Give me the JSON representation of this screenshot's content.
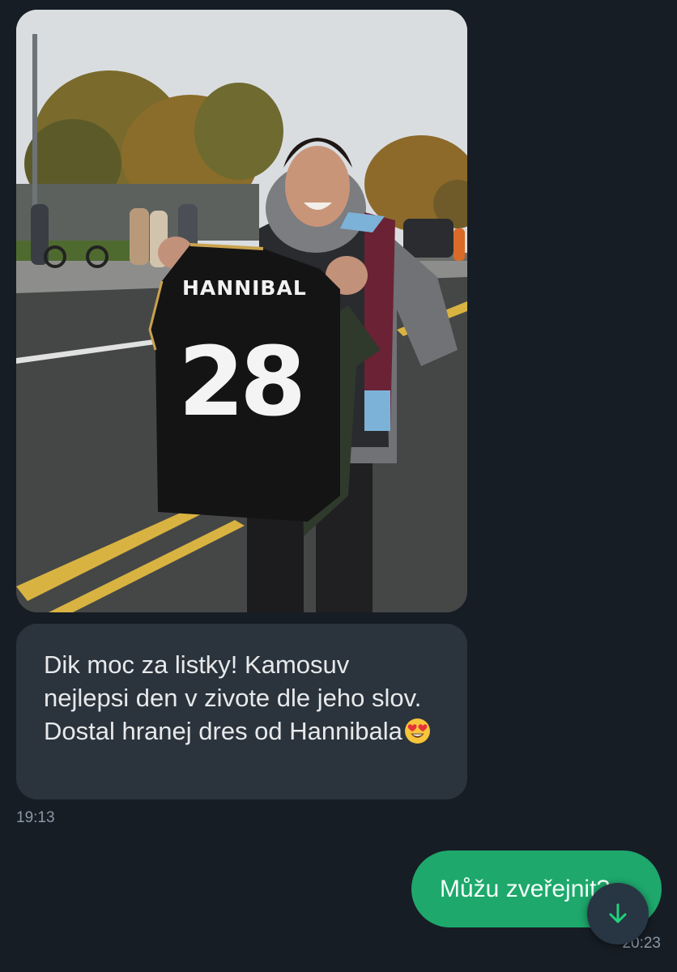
{
  "chat": {
    "messages": [
      {
        "direction": "incoming",
        "type": "image",
        "image": {
          "jersey_name": "HANNIBAL",
          "jersey_number": "28"
        }
      },
      {
        "direction": "incoming",
        "type": "text",
        "text": "Dik moc za listky! Kamosuv nejlepsi den v zivote dle jeho slov. Dostal hranej dres od Hannibala",
        "emoji": "smiling-face-with-heart-eyes",
        "time": "19:13"
      },
      {
        "direction": "outgoing",
        "type": "text",
        "text": "Můžu zveřejnit?",
        "time": "20:23"
      }
    ]
  },
  "scroll_button": {
    "icon": "arrow-down-icon"
  },
  "colors": {
    "background": "#161d25",
    "incoming_bubble": "#2b333d",
    "outgoing_bubble": "#1ea86c",
    "accent_green": "#1ed37a",
    "timestamp": "#8b98a5"
  }
}
